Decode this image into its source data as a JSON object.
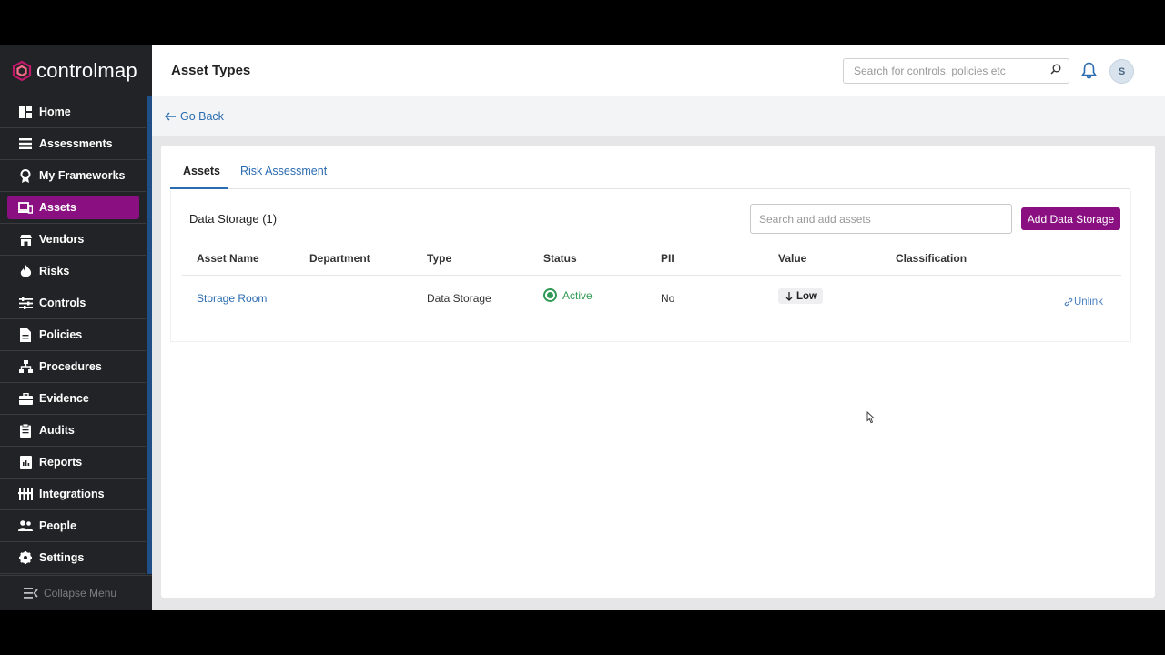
{
  "app": {
    "brand": "controlmap"
  },
  "sidebar": {
    "items": [
      {
        "label": "Home",
        "icon": "home-icon",
        "active": false
      },
      {
        "label": "Assessments",
        "icon": "assessments-icon",
        "active": false
      },
      {
        "label": "My Frameworks",
        "icon": "frameworks-icon",
        "active": false
      },
      {
        "label": "Assets",
        "icon": "assets-icon",
        "active": true
      },
      {
        "label": "Vendors",
        "icon": "vendors-icon",
        "active": false
      },
      {
        "label": "Risks",
        "icon": "risks-icon",
        "active": false
      },
      {
        "label": "Controls",
        "icon": "controls-icon",
        "active": false
      },
      {
        "label": "Policies",
        "icon": "policies-icon",
        "active": false
      },
      {
        "label": "Procedures",
        "icon": "procedures-icon",
        "active": false
      },
      {
        "label": "Evidence",
        "icon": "evidence-icon",
        "active": false
      },
      {
        "label": "Audits",
        "icon": "audits-icon",
        "active": false
      },
      {
        "label": "Reports",
        "icon": "reports-icon",
        "active": false
      },
      {
        "label": "Integrations",
        "icon": "integrations-icon",
        "active": false
      },
      {
        "label": "People",
        "icon": "people-icon",
        "active": false
      },
      {
        "label": "Settings",
        "icon": "settings-icon",
        "active": false
      }
    ],
    "collapse_label": "Collapse Menu"
  },
  "header": {
    "title": "Asset Types",
    "search_placeholder": "Search for controls, policies etc",
    "avatar_initial": "S"
  },
  "nav": {
    "go_back": "Go Back"
  },
  "tabs": [
    {
      "label": "Assets",
      "active": true
    },
    {
      "label": "Risk Assessment",
      "active": false
    }
  ],
  "section": {
    "title": "Data Storage (1)",
    "search_placeholder": "Search and add assets",
    "add_button": "Add Data Storage"
  },
  "table": {
    "columns": [
      "Asset Name",
      "Department",
      "Type",
      "Status",
      "PII",
      "Value",
      "Classification"
    ],
    "rows": [
      {
        "asset_name": "Storage Room",
        "department": "",
        "type": "Data Storage",
        "status": "Active",
        "pii": "No",
        "value": "Low",
        "classification": "",
        "action": "Unlink"
      }
    ]
  },
  "colors": {
    "accent": "#8a1081",
    "link": "#2b6cb0",
    "sidebar_bg": "#222326",
    "status_active": "#2f9a54"
  }
}
